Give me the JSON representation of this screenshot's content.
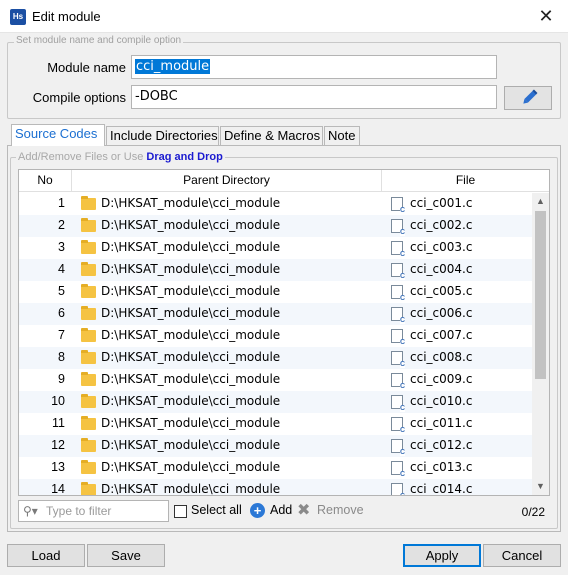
{
  "window": {
    "app_icon_text": "Hs",
    "title": "Edit module",
    "close_glyph": "✕"
  },
  "module_group": {
    "legend": "Set module name and compile option",
    "name_label": "Module name",
    "name_value": "cci_module",
    "options_label": "Compile options",
    "options_value": "-DOBC"
  },
  "tabs": [
    "Source Codes",
    "Include Directories",
    "Define & Macros",
    "Note"
  ],
  "active_tab": 0,
  "hint": {
    "prefix": "Add/Remove Files or Use ",
    "emphasis": "Drag and Drop"
  },
  "table": {
    "columns": [
      "No",
      "Parent Directory",
      "File"
    ],
    "rows": [
      {
        "no": "1",
        "dir": "D:\\HKSAT_module\\cci_module",
        "file": "cci_c001.c"
      },
      {
        "no": "2",
        "dir": "D:\\HKSAT_module\\cci_module",
        "file": "cci_c002.c"
      },
      {
        "no": "3",
        "dir": "D:\\HKSAT_module\\cci_module",
        "file": "cci_c003.c"
      },
      {
        "no": "4",
        "dir": "D:\\HKSAT_module\\cci_module",
        "file": "cci_c004.c"
      },
      {
        "no": "5",
        "dir": "D:\\HKSAT_module\\cci_module",
        "file": "cci_c005.c"
      },
      {
        "no": "6",
        "dir": "D:\\HKSAT_module\\cci_module",
        "file": "cci_c006.c"
      },
      {
        "no": "7",
        "dir": "D:\\HKSAT_module\\cci_module",
        "file": "cci_c007.c"
      },
      {
        "no": "8",
        "dir": "D:\\HKSAT_module\\cci_module",
        "file": "cci_c008.c"
      },
      {
        "no": "9",
        "dir": "D:\\HKSAT_module\\cci_module",
        "file": "cci_c009.c"
      },
      {
        "no": "10",
        "dir": "D:\\HKSAT_module\\cci_module",
        "file": "cci_c010.c"
      },
      {
        "no": "11",
        "dir": "D:\\HKSAT_module\\cci_module",
        "file": "cci_c011.c"
      },
      {
        "no": "12",
        "dir": "D:\\HKSAT_module\\cci_module",
        "file": "cci_c012.c"
      },
      {
        "no": "13",
        "dir": "D:\\HKSAT_module\\cci_module",
        "file": "cci_c013.c"
      },
      {
        "no": "14",
        "dir": "D:\\HKSAT_module\\cci_module",
        "file": "cci_c014.c"
      }
    ]
  },
  "toolbar": {
    "filter_placeholder": "Type to filter",
    "select_all": "Select all",
    "add": "Add",
    "remove": "Remove",
    "count": "0/22"
  },
  "buttons": {
    "load": "Load",
    "save": "Save",
    "apply": "Apply",
    "cancel": "Cancel"
  },
  "colors": {
    "accent": "#0078d7",
    "selection": "#0078d7",
    "hint_emphasis": "#1a1ad0",
    "folder": "#f5c342"
  },
  "icons": {
    "app": "hs-app-icon",
    "close": "close-icon",
    "edit": "pencil-icon",
    "folder": "folder-icon",
    "file": "c-file-icon",
    "filter": "search-icon",
    "add": "plus-circle-icon",
    "remove": "x-icon"
  }
}
